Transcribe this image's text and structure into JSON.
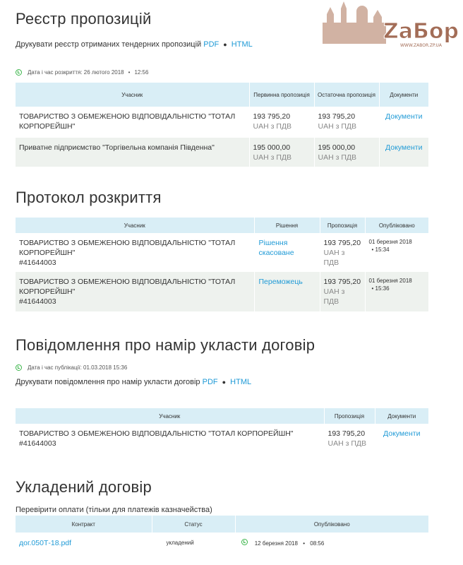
{
  "logo": {
    "text": "ZaБор",
    "url_text": "WWW.ZABOR.ZP.UA"
  },
  "registry": {
    "title": "Реєстр пропозицій",
    "print_text": "Друкувати реєстр отриманих тендерних пропозицій",
    "pdf": "PDF",
    "sep": "●",
    "html": "HTML",
    "opened_label": "Дата і час розкриття: 26 лютого 2018",
    "opened_dot": "•",
    "opened_time": "12:56",
    "headers": [
      "Учасник",
      "Первинна пропозиція",
      "Остаточна пропозиція",
      "Документи"
    ],
    "rows": [
      {
        "participant": "ТОВАРИСТВО З ОБМЕЖЕНОЮ ВІДПОВІДАЛЬНІСТЮ \"ТОТАЛ КОРПОРЕЙШН\"",
        "initial": "193 795,20",
        "initial_unit": "UAH з ПДВ",
        "final": "193 795,20",
        "final_unit": "UAH з ПДВ",
        "docs": "Документи"
      },
      {
        "participant": "Приватне підприємство \"Торгівельна компанія Південна\"",
        "initial": "195 000,00",
        "initial_unit": "UAH з ПДВ",
        "final": "195 000,00",
        "final_unit": "UAH з ПДВ",
        "docs": "Документи"
      }
    ]
  },
  "protocol": {
    "title": "Протокол розкриття",
    "headers": [
      "Учасник",
      "Рішення",
      "Пропозиція",
      "Опубліковано"
    ],
    "rows": [
      {
        "participant": "ТОВАРИСТВО З ОБМЕЖЕНОЮ ВІДПОВІДАЛЬНІСТЮ \"ТОТАЛ КОРПОРЕЙШН\"",
        "code": "#41644003",
        "decision": "Рішення скасоване",
        "amount": "193 795,20",
        "unit": "UAH з ПДВ",
        "date": "01 березня 2018",
        "dot": "•",
        "time": "15:34"
      },
      {
        "participant": "ТОВАРИСТВО З ОБМЕЖЕНОЮ ВІДПОВІДАЛЬНІСТЮ \"ТОТАЛ КОРПОРЕЙШН\"",
        "code": "#41644003",
        "decision": "Переможець",
        "amount": "193 795,20",
        "unit": "UAH з ПДВ",
        "date": "01 березня 2018",
        "dot": "•",
        "time": "15:36"
      }
    ]
  },
  "intent": {
    "title": "Повідомлення про намір укласти договір",
    "published_label": "Дата і час публікації: 01.03.2018 15:36",
    "print_text": "Друкувати повідомлення про намір укласти договір",
    "pdf": "PDF",
    "sep": "●",
    "html": "HTML",
    "headers": [
      "Учасник",
      "Пропозиція",
      "Документи"
    ],
    "rows": [
      {
        "participant": "ТОВАРИСТВО З ОБМЕЖЕНОЮ ВІДПОВІДАЛЬНІСТЮ \"ТОТАЛ КОРПОРЕЙШН\"",
        "code": "#41644003",
        "amount": "193 795,20",
        "unit": "UAH з ПДВ",
        "docs": "Документи"
      }
    ]
  },
  "contract": {
    "title": "Укладений договір",
    "check_link": "Перевірити оплати (тільки для платежів казначейства)",
    "headers": [
      "Контракт",
      "Статус",
      "Опубліковано"
    ],
    "rows": [
      {
        "file": "дог.050Т-18.pdf",
        "status": "укладений",
        "date": "12 березня 2018",
        "dot": "•",
        "time": "08:56"
      }
    ]
  },
  "colors": {
    "link": "#1f9ad6",
    "header_bg": "#d9eef6",
    "alt_row_bg": "#eef2ee",
    "clock": "#3bb54a",
    "logo_brown": "#a36d57"
  }
}
